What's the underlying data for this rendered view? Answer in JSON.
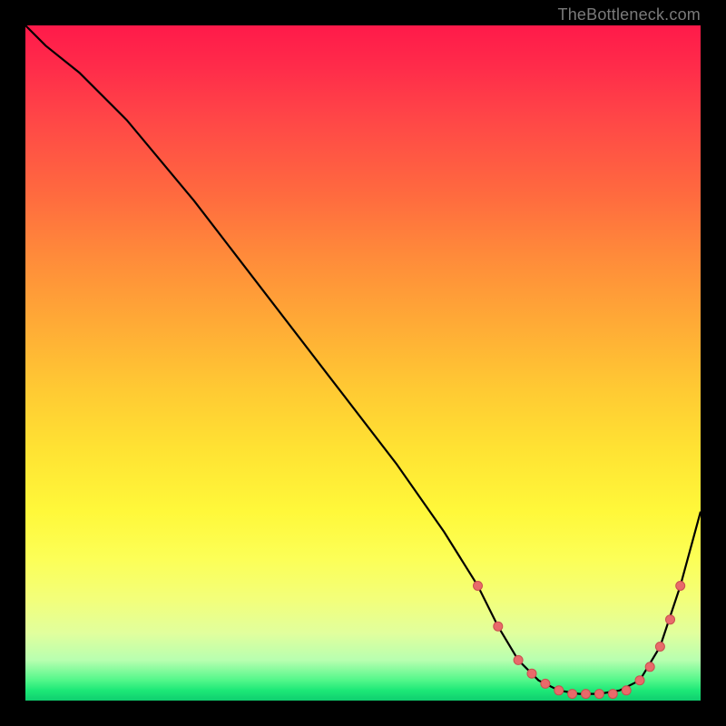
{
  "watermark": "TheBottleneck.com",
  "colors": {
    "curve": "#000000",
    "dot_fill": "#e86a6a",
    "dot_stroke": "#c94f4f",
    "gradient_top": "#ff1a4a",
    "gradient_bottom": "#0fce6f"
  },
  "chart_data": {
    "type": "line",
    "title": "",
    "xlabel": "",
    "ylabel": "",
    "xlim": [
      0,
      100
    ],
    "ylim": [
      0,
      100
    ],
    "grid": false,
    "series": [
      {
        "name": "bottleneck-curve",
        "x": [
          0,
          3,
          8,
          15,
          25,
          35,
          45,
          55,
          62,
          67,
          70,
          73,
          76,
          79,
          82,
          85,
          88,
          91,
          94,
          97,
          100
        ],
        "y": [
          100,
          97,
          93,
          86,
          74,
          61,
          48,
          35,
          25,
          17,
          11,
          6,
          3,
          1.5,
          1,
          1,
          1.5,
          3,
          8,
          17,
          28
        ]
      }
    ],
    "highlight_points": {
      "name": "highlighted-dots",
      "x": [
        67,
        70,
        73,
        75,
        77,
        79,
        81,
        83,
        85,
        87,
        89,
        91,
        92.5,
        94,
        95.5,
        97
      ],
      "y": [
        17,
        11,
        6,
        4,
        2.5,
        1.5,
        1,
        1,
        1,
        1,
        1.5,
        3,
        5,
        8,
        12,
        17
      ]
    }
  }
}
